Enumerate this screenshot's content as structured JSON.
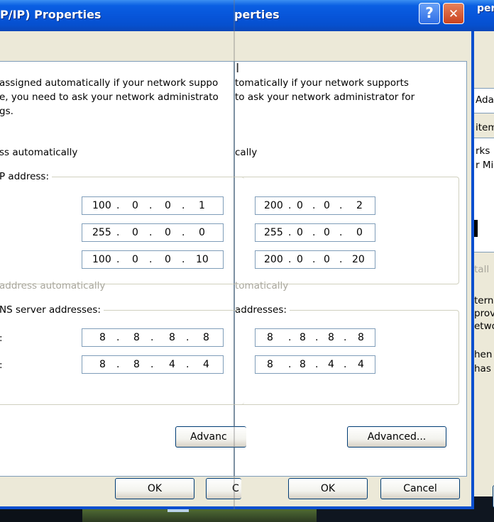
{
  "dialog_left": {
    "title": "P/IP) Properties",
    "desc_line1": "assigned automatically if your network suppo",
    "desc_line2": "e, you need to ask your network administrato",
    "desc_line3": "gs.",
    "obtain_ip_auto": "ss automatically",
    "use_ip_group": "P address:",
    "ip_address": [
      "100",
      "0",
      "0",
      "1"
    ],
    "subnet_mask": [
      "255",
      "0",
      "0",
      "0"
    ],
    "default_gateway": [
      "100",
      "0",
      "0",
      "10"
    ],
    "obtain_dns_auto": "address automatically",
    "use_dns_group": "NS server addresses:",
    "preferred_dns_label": ":",
    "alternate_dns_label": ":",
    "preferred_dns": [
      "8",
      "8",
      "8",
      "8"
    ],
    "alternate_dns": [
      "8",
      "8",
      "4",
      "4"
    ],
    "advanced_button": "Advanc",
    "ok_button": "OK",
    "cancel_button": "C"
  },
  "dialog_right": {
    "title": "perties",
    "desc_line1": "tomatically if your network supports",
    "desc_line2": "to ask your network administrator for",
    "obtain_ip_auto": "cally",
    "ip_address": [
      "200",
      "0",
      "0",
      "2"
    ],
    "subnet_mask": [
      "255",
      "0",
      "0",
      "0"
    ],
    "default_gateway": [
      "200",
      "0",
      "0",
      "20"
    ],
    "obtain_dns_auto": "tomatically",
    "use_dns_group": "addresses:",
    "preferred_dns": [
      "8",
      "8",
      "8",
      "8"
    ],
    "alternate_dns": [
      "8",
      "8",
      "4",
      "4"
    ],
    "advanced_button": "Advanced...",
    "ok_button": "OK",
    "cancel_button": "Cancel",
    "help_glyph": "?",
    "close_glyph": "✕"
  },
  "background_window": {
    "title": "per",
    "frag1": "Ada",
    "frag2": "item",
    "frag3": "rks",
    "frag4": "r Mic",
    "frag5": "tall",
    "frag6": "tern",
    "frag7": "prov",
    "frag8": "etwo",
    "frag9": "hen",
    "frag10": "has"
  }
}
